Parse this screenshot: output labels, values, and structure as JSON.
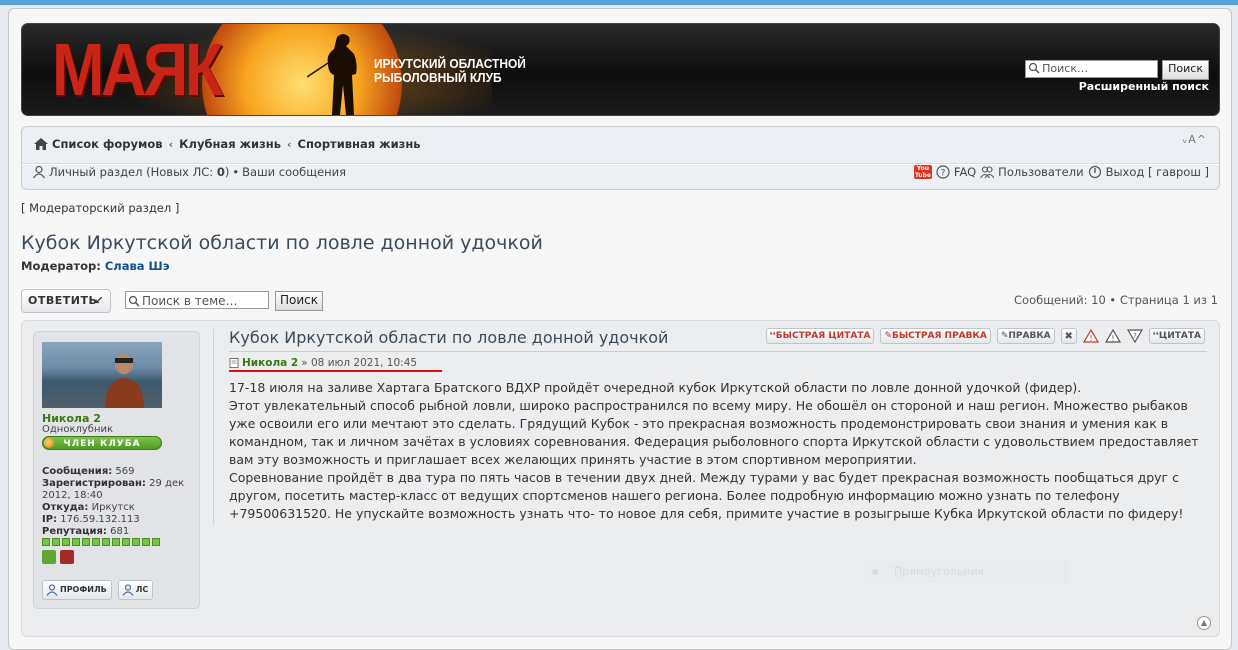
{
  "header": {
    "logo_text": "МАЯК",
    "club_line1": "ИРКУТСКИЙ ОБЛАСТНОЙ",
    "club_line2": "РЫБОЛОВНЫЙ КЛУБ",
    "search_placeholder": "Поиск…",
    "search_button": "Поиск",
    "advanced_search": "Расширенный поиск"
  },
  "breadcrumbs": [
    "Список форумов",
    "Клубная жизнь",
    "Спортивная жизнь"
  ],
  "font_controls": "ᵥA^",
  "nav": {
    "personal": "Личный раздел (Новых ЛС: ",
    "new_pm_count": "0",
    "personal_close": ")",
    "my_posts": "Ваши сообщения",
    "faq": "FAQ",
    "users": "Пользователи",
    "logout": "Выход [ гаврош ]"
  },
  "moderator_section": "[ Модераторский раздел ]",
  "topic": {
    "title": "Кубок Иркутской области по ловле донной удочкой",
    "moderator_label": "Модератор:",
    "moderator_name": "Слава Шэ"
  },
  "toolbar": {
    "reply_label": "ОТВЕТИТЬ",
    "topic_search_placeholder": "Поиск в теме…",
    "topic_search_button": "Поиск",
    "page_info": "Сообщений: 10 • Страница 1 из 1"
  },
  "post": {
    "author": "Никола 2",
    "rank": "Одноклубник",
    "rank_badge": "ЧЛЕН КЛУБА",
    "stats": {
      "posts_label": "Сообщения:",
      "posts": "569",
      "registered_label": "Зарегистрирован:",
      "registered": "29 дек 2012, 18:40",
      "from_label": "Откуда:",
      "from": "Иркутск",
      "ip_label": "IP:",
      "ip": "176.59.132.113",
      "rep_label": "Репутация:",
      "rep": "681"
    },
    "profile_button": "ПРОФИЛЬ",
    "pm_button": "ЛС",
    "title": "Кубок Иркутской области по ловле донной удочкой",
    "actions": {
      "quick_quote": "БЫСТРАЯ ЦИТАТА",
      "quick_edit": "БЫСТРАЯ ПРАВКА",
      "edit": "ПРАВКА",
      "quote": "ЦИТАТА"
    },
    "byline_author": "Никола 2",
    "byline_date": "» 08 июл 2021, 10:45",
    "paragraphs": [
      "17-18 июля на заливе Хартага Братского ВДХР пройдёт очередной кубок Иркутской области по ловле донной удочкой (фидер).",
      "Этот увлекательный способ рыбной ловли, широко распространился по всему миру. Не обошёл он стороной и наш регион. Множество рыбаков уже освоили его или мечтают это сделать. Грядущий Кубок - это прекрасная возможность продемонстрировать свои знания и умения как в командном, так и личном зачётах в условиях соревнования. Федерация рыболовного спорта Иркутской области с удовольствием предоставляет вам эту возможность и приглашает всех желающих принять участие в этом спортивном мероприятии.",
      "Соревнование пройдёт в два тура по пять часов в течении двух дней. Между турами у вас будет прекрасная возможность пообщаться друг с другом, посетить мастер-класс от ведущих спортсменов нашего региона. Более подробную информацию можно узнать по телефону +79500631520. Не упускайте возможность узнать что- то новое для себя, примите участие в розыгрыше Кубка Иркутской области по фидеру!"
    ],
    "overlay_label": "Прямоугольник"
  },
  "colors": {
    "accent_green": "#3a7a10",
    "link_blue": "#105289",
    "logo_red": "#c92418",
    "highlight_red": "#dd1111"
  }
}
